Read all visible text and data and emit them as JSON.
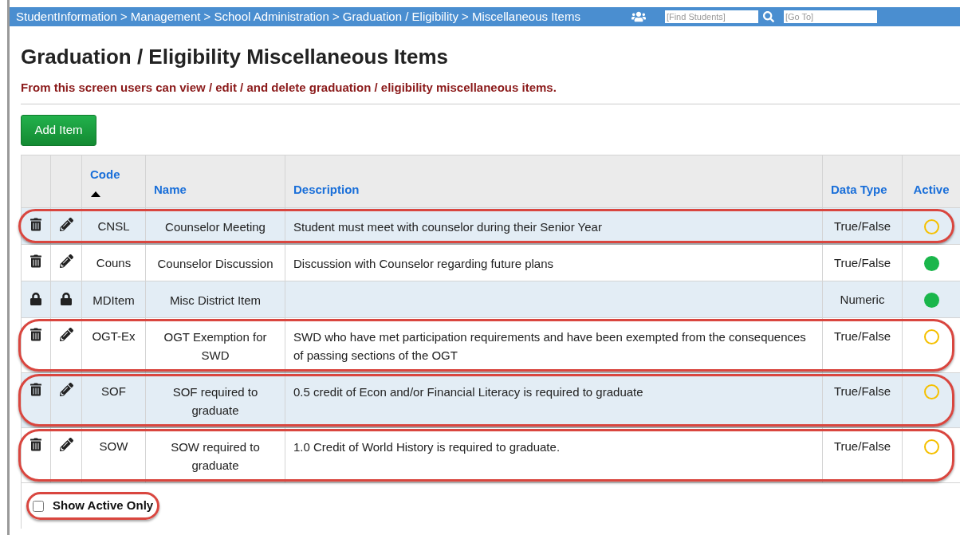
{
  "breadcrumb": "StudentInformation > Management > School Administration > Graduation / Eligibility > Miscellaneous Items",
  "search_fields": [
    {
      "placeholder": "[Find Students]"
    },
    {
      "placeholder": "[Go To]"
    }
  ],
  "title": "Graduation / Eligibility Miscellaneous Items",
  "subtitle": "From this screen users can view / edit / and delete graduation / eligibility miscellaneous items.",
  "add_button": "Add Item",
  "table": {
    "columns": [
      {
        "label": "Code",
        "sorted": true
      },
      {
        "label": "Name",
        "sorted": false
      },
      {
        "label": "Description",
        "sorted": false
      },
      {
        "label": "Data Type",
        "sorted": false
      },
      {
        "label": "Active",
        "sorted": false
      }
    ],
    "rows": [
      {
        "code": "CNSL",
        "name": "Counselor Meeting",
        "description": "Student must meet with counselor during their Senior Year",
        "data_type": "True/False",
        "active": false,
        "locked": false,
        "highlighted": true
      },
      {
        "code": "Couns",
        "name": "Counselor Discussion",
        "description": "Discussion with Counselor regarding future plans",
        "data_type": "True/False",
        "active": true,
        "locked": false,
        "highlighted": false
      },
      {
        "code": "MDItem",
        "name": "Misc District Item",
        "description": "",
        "data_type": "Numeric",
        "active": true,
        "locked": true,
        "highlighted": false
      },
      {
        "code": "OGT-Ex",
        "name": "OGT Exemption for SWD",
        "description": "SWD who have met participation requirements and have been exempted from the consequences of passing sections of the OGT",
        "data_type": "True/False",
        "active": false,
        "locked": false,
        "highlighted": true
      },
      {
        "code": "SOF",
        "name": "SOF required to graduate",
        "description": "0.5 credit of Econ and/or Financial Literacy is required to graduate",
        "data_type": "True/False",
        "active": false,
        "locked": false,
        "highlighted": true
      },
      {
        "code": "SOW",
        "name": "SOW required to graduate",
        "description": "1.0 Credit of World History is required to graduate.",
        "data_type": "True/False",
        "active": false,
        "locked": false,
        "highlighted": true
      }
    ]
  },
  "show_active_only": {
    "label": "Show Active Only",
    "checked": false,
    "highlighted": true
  }
}
